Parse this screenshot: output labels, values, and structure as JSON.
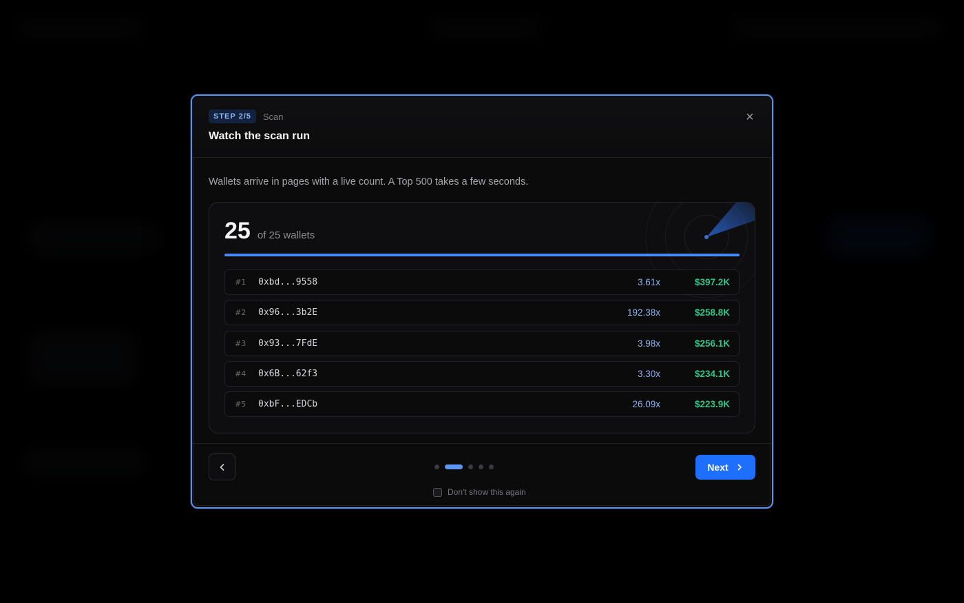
{
  "modal": {
    "step_badge": "STEP 2/5",
    "step_name": "Scan",
    "title": "Watch the scan run",
    "close_glyph": "×",
    "description": "Wallets arrive in pages with a live count. A Top 500 takes a few seconds."
  },
  "scan": {
    "count": "25",
    "count_label": "of 25 wallets",
    "progress": 1.0
  },
  "wallets": [
    {
      "rank": "#1",
      "address": "0xbd...9558",
      "multiplier": "3.61x",
      "value": "$397.2K"
    },
    {
      "rank": "#2",
      "address": "0x96...3b2E",
      "multiplier": "192.38x",
      "value": "$258.8K"
    },
    {
      "rank": "#3",
      "address": "0x93...7FdE",
      "multiplier": "3.98x",
      "value": "$256.1K"
    },
    {
      "rank": "#4",
      "address": "0x6B...62f3",
      "multiplier": "3.30x",
      "value": "$234.1K"
    },
    {
      "rank": "#5",
      "address": "0xbF...EDCb",
      "multiplier": "26.09x",
      "value": "$223.9K"
    }
  ],
  "footer": {
    "next_label": "Next",
    "dont_show_label": "Don't show this again",
    "pager_total": 5,
    "pager_active": 2,
    "dont_show_checked": false
  },
  "colors": {
    "accent": "#1f6fff",
    "multiplier": "#8fb3ef",
    "value": "#2fc48a",
    "modal_border": "#5b8fe8"
  },
  "icons": {
    "back": "chevron-left-icon",
    "next": "chevron-right-icon",
    "close": "close-icon",
    "radar": "radar-icon"
  }
}
